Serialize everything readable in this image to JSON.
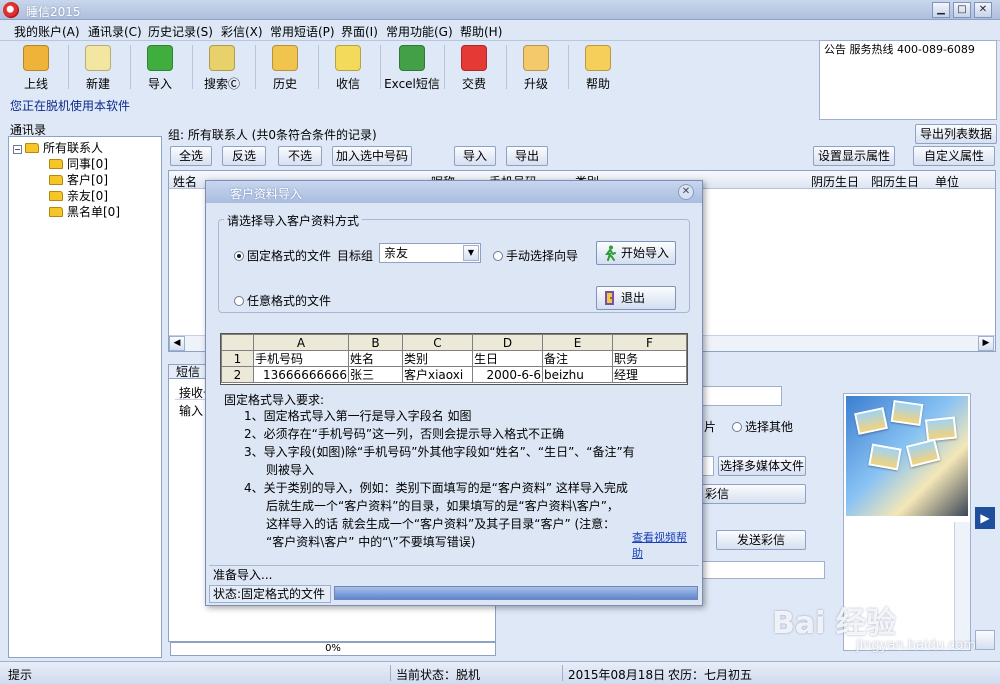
{
  "window": {
    "title": "睡信2015"
  },
  "menu": [
    "我的账户(A)",
    "通讯录(C)",
    "历史记录(S)",
    "彩信(X)",
    "常用短语(P)",
    "界面(I)",
    "常用功能(G)",
    "帮助(H)"
  ],
  "toolbar": [
    {
      "label": "上线",
      "icon": "online-person-icon",
      "color": "#f0b33a"
    },
    {
      "label": "新建",
      "icon": "new-pencil-icon",
      "color": "#f3e6a0"
    },
    {
      "label": "导入",
      "icon": "import-arrow-icon",
      "color": "#3fae3f"
    },
    {
      "label": "搜索Ⓒ",
      "icon": "search-icon",
      "color": "#e8d16a"
    },
    {
      "label": "历史",
      "icon": "history-clock-icon",
      "color": "#f1c44d"
    },
    {
      "label": "收信",
      "icon": "inbox-icon",
      "color": "#f3da5b"
    },
    {
      "label": "Excel短信",
      "icon": "excel-icon",
      "color": "#43a047"
    },
    {
      "label": "交费",
      "icon": "yen-icon",
      "color": "#e53935"
    },
    {
      "label": "升级",
      "icon": "upgrade-icon",
      "color": "#f3c96b"
    },
    {
      "label": "帮助",
      "icon": "help-icon",
      "color": "#f5cf5a"
    }
  ],
  "offline_note": "您正在脱机使用本软件",
  "announce": {
    "text": "公告 服务热线 400-089-6089"
  },
  "tree": {
    "title": "通讯录",
    "root": "所有联系人",
    "toggle": "⊟",
    "children": [
      "同事[0]",
      "客户[0]",
      "亲友[0]",
      "黑名单[0]"
    ]
  },
  "group_label": "组: 所有联系人 (共0条符合条件的记录)",
  "buttons": {
    "select_all": "全选",
    "invert": "反选",
    "deselect": "不选",
    "add_selected": "加入选中号码",
    "import": "导入",
    "export": "导出",
    "export_list": "导出列表数据",
    "display_props": "设置显示属性",
    "custom_props": "自定义属性",
    "send_mms": "发送彩信",
    "select_media": "选择多媒体文件",
    "mms_frag": "彩信"
  },
  "columns": [
    "姓名",
    "昵称",
    "手机号码",
    "类别",
    "阴历生日",
    "阳历生日",
    "单位"
  ],
  "compose": {
    "tab": "短信",
    "receiver": "接收号",
    "input": "输入",
    "progress": "0%",
    "photo_frag": "片",
    "other": "选择其他"
  },
  "statusbar": {
    "hint": "提示",
    "state": "当前状态：脱机",
    "date": "2015年08月18日",
    "lunar": "农历：七月初五"
  },
  "dialog": {
    "title": "客户资料导入",
    "close": "✕",
    "group_title": "请选择导入客户资料方式",
    "fixed_format": "固定格式的文件",
    "target_group_label": "目标组",
    "target_group_value": "亲友",
    "manual_wizard": "手动选择向导",
    "start_import": "开始导入",
    "any_format": "任意格式的文件",
    "exit": "退出",
    "sheet": {
      "col_letters": [
        "A",
        "B",
        "C",
        "D",
        "E",
        "F"
      ],
      "rows": [
        {
          "n": "1",
          "cells": [
            "手机号码",
            "姓名",
            "类别",
            "生日",
            "备注",
            "职务"
          ]
        },
        {
          "n": "2",
          "cells": [
            "13666666666",
            "张三",
            "客户xiaoxi",
            "2000-6-6",
            "beizhu",
            "经理"
          ]
        }
      ]
    },
    "req_title": "固定格式导入要求:",
    "req_lines": [
      "1、固定格式导入第一行是导入字段名 如图",
      "2、必须存在“手机号码”这一列，否则会提示导入格式不正确",
      "3、导入字段(如图)除“手机号码”外其他字段如“姓名”、“生日”、“备注”有",
      "则被导入",
      "4、关于类别的导入，例如：类别下面填写的是“客户资料” 这样导入完成",
      "后就生成一个“客户资料”的目录，如果填写的是“客户资料\\客户”，",
      "这样导入的话 就会生成一个“客户资料”及其子目录“客户” (注意：",
      "“客户资料\\客户” 中的“\\”不要填写错误)"
    ],
    "help_link": "查看视频帮助",
    "status_ready": "准备导入...",
    "status_mode": "状态:固定格式的文件"
  },
  "watermark": {
    "main": "Bai 经验",
    "sub": "jingyan.baidu.com"
  }
}
